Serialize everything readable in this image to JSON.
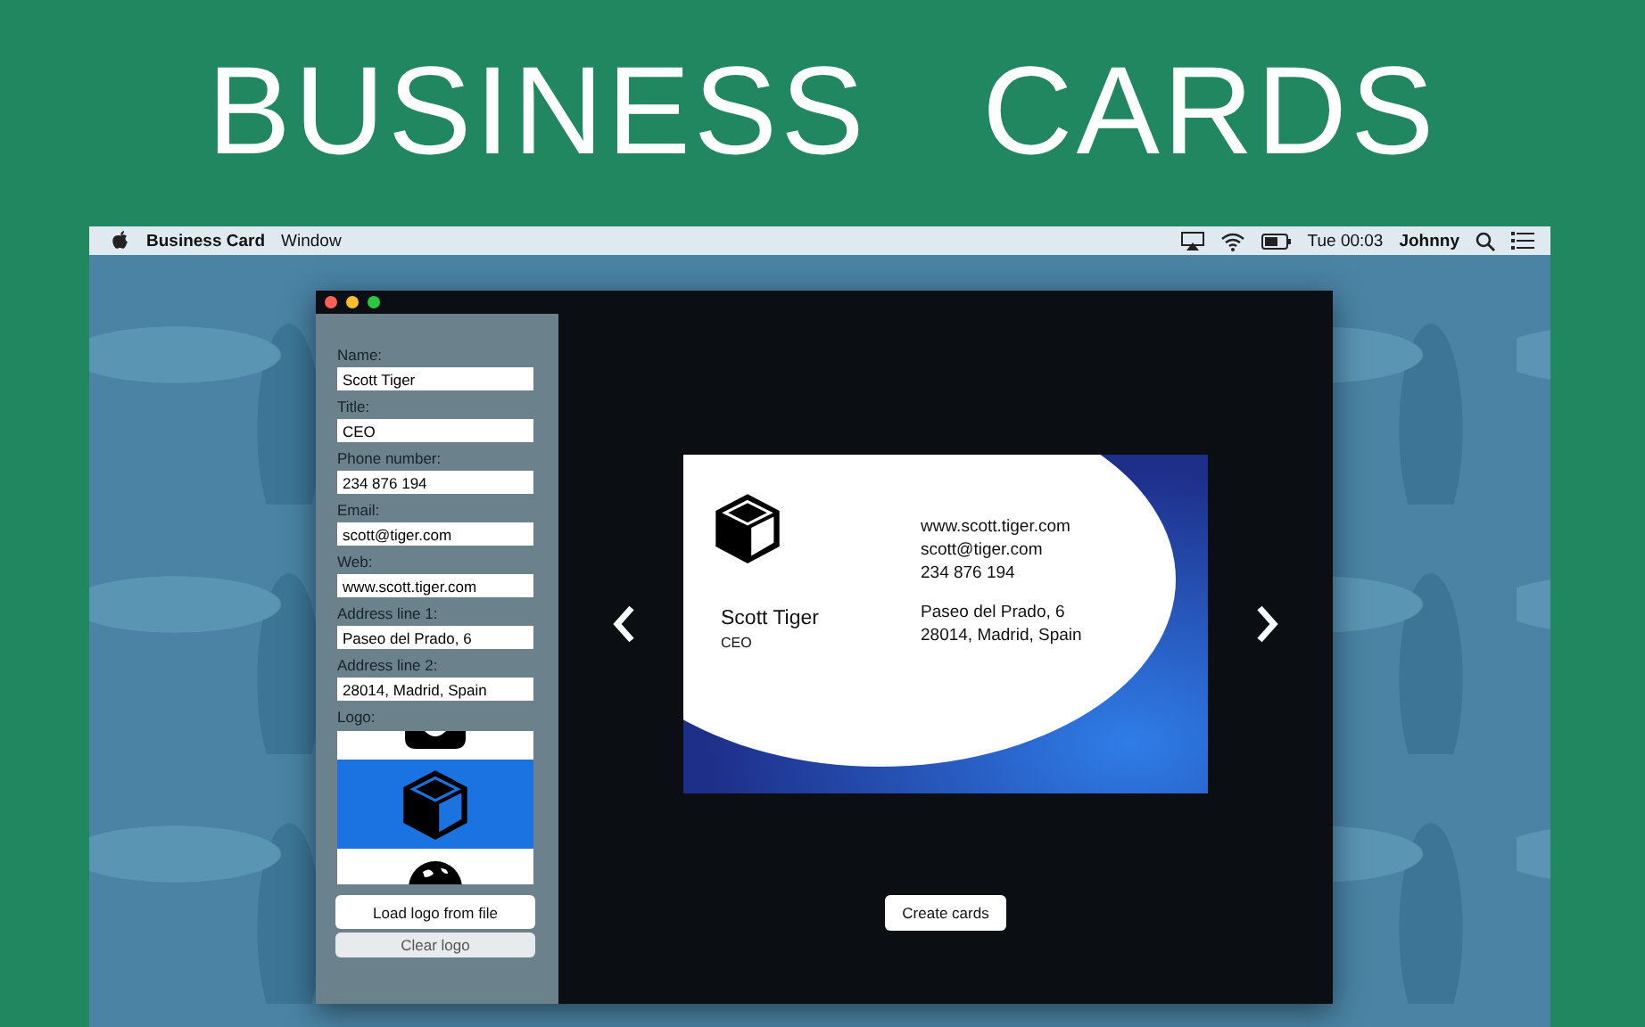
{
  "banner": {
    "title": "BUSINESS   CARDS"
  },
  "menu_bar": {
    "app": "Business Card",
    "menus": [
      "Window"
    ],
    "clock": "Tue 00:03",
    "user": "Johnny"
  },
  "form": {
    "fields": [
      {
        "label": "Name:",
        "value": "Scott Tiger"
      },
      {
        "label": "Title:",
        "value": "CEO"
      },
      {
        "label": "Phone number:",
        "value": "234 876 194"
      },
      {
        "label": "Email:",
        "value": "scott@tiger.com"
      },
      {
        "label": "Web:",
        "value": "www.scott.tiger.com"
      },
      {
        "label": "Address line 1:",
        "value": "Paseo del Prado, 6"
      },
      {
        "label": "Address line 2:",
        "value": "28014, Madrid, Spain"
      }
    ],
    "logo_label": "Logo:",
    "logos": [
      {
        "kind": "badge",
        "selected": false
      },
      {
        "kind": "cube",
        "selected": true
      },
      {
        "kind": "globe",
        "selected": false
      }
    ],
    "buttons": [
      {
        "label": "Load logo from file",
        "disabled": false
      },
      {
        "label": "Clear logo",
        "disabled": true
      }
    ]
  },
  "card": {
    "name": "Scott Tiger",
    "title": "CEO",
    "web": "www.scott.tiger.com",
    "email": "scott@tiger.com",
    "phone": "234 876 194",
    "address_1": "Paseo del Prado, 6",
    "address_2": "28014, Madrid, Spain"
  },
  "create_button": "Create cards"
}
